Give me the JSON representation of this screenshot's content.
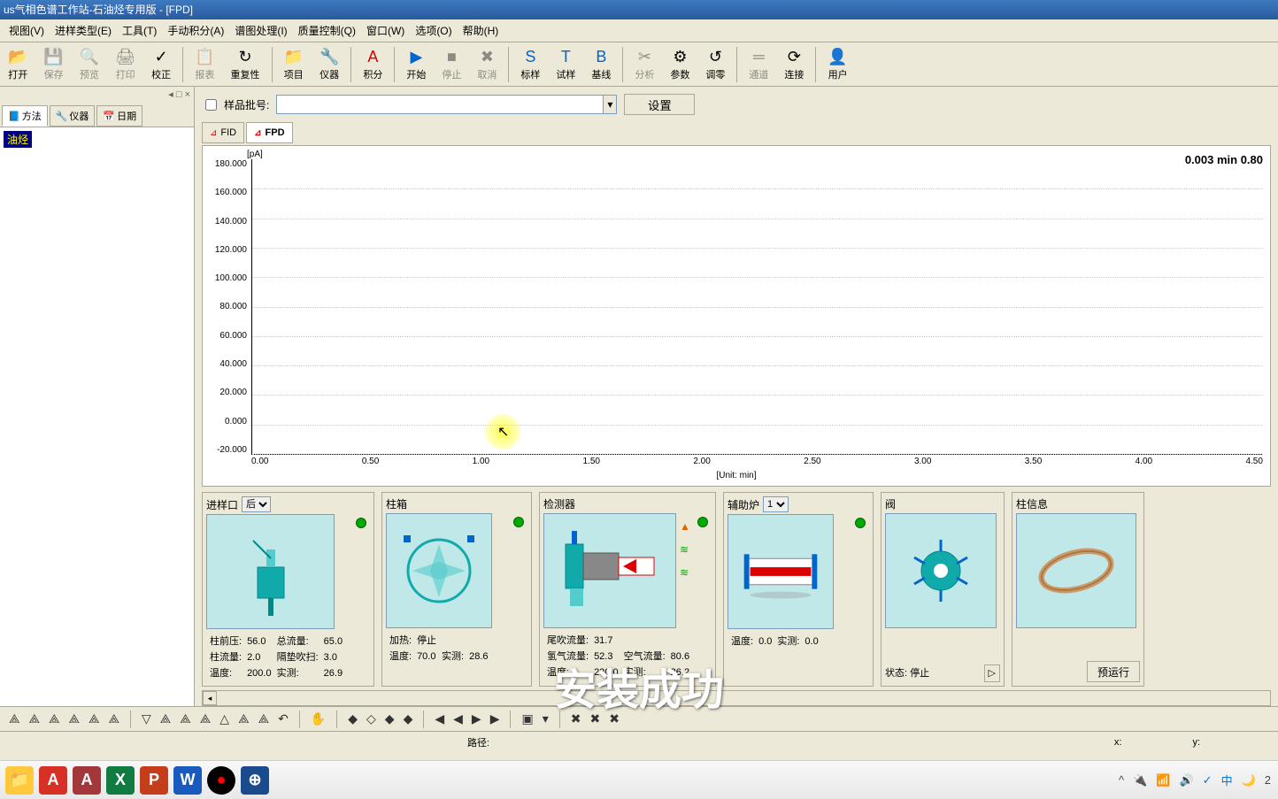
{
  "title": "us气相色谱工作站-石油烃专用版 - [FPD]",
  "menu": [
    "视图(V)",
    "进样类型(E)",
    "工具(T)",
    "手动积分(A)",
    "谱图处理(I)",
    "质量控制(Q)",
    "窗口(W)",
    "选项(O)",
    "帮助(H)"
  ],
  "toolbar": [
    {
      "icon": "📂",
      "label": "打开",
      "enabled": true
    },
    {
      "icon": "💾",
      "label": "保存",
      "enabled": false
    },
    {
      "icon": "🔍",
      "label": "预览",
      "enabled": false
    },
    {
      "icon": "🖨",
      "label": "打印",
      "enabled": false
    },
    {
      "icon": "✓",
      "label": "校正",
      "enabled": true
    },
    {
      "sep": true
    },
    {
      "icon": "📋",
      "label": "报表",
      "enabled": false
    },
    {
      "icon": "↻",
      "label": "重复性",
      "enabled": true
    },
    {
      "sep": true
    },
    {
      "icon": "📁",
      "label": "项目",
      "enabled": true
    },
    {
      "icon": "🔧",
      "label": "仪器",
      "enabled": true
    },
    {
      "sep": true
    },
    {
      "icon": "A",
      "label": "积分",
      "enabled": true,
      "color": "#d00"
    },
    {
      "sep": true
    },
    {
      "icon": "▶",
      "label": "开始",
      "enabled": true,
      "color": "#06c"
    },
    {
      "icon": "■",
      "label": "停止",
      "enabled": false
    },
    {
      "icon": "✖",
      "label": "取消",
      "enabled": false
    },
    {
      "sep": true
    },
    {
      "icon": "S",
      "label": "标样",
      "enabled": true,
      "color": "#06c"
    },
    {
      "icon": "T",
      "label": "试样",
      "enabled": true,
      "color": "#06c"
    },
    {
      "icon": "B",
      "label": "基线",
      "enabled": true,
      "color": "#06c"
    },
    {
      "sep": true
    },
    {
      "icon": "✂",
      "label": "分析",
      "enabled": false
    },
    {
      "icon": "⚙",
      "label": "参数",
      "enabled": true
    },
    {
      "icon": "↺",
      "label": "调零",
      "enabled": true
    },
    {
      "sep": true
    },
    {
      "icon": "═",
      "label": "通道",
      "enabled": false
    },
    {
      "icon": "⟳",
      "label": "连接",
      "enabled": true
    },
    {
      "sep": true
    },
    {
      "icon": "👤",
      "label": "用户",
      "enabled": true
    }
  ],
  "sidebar": {
    "closeLabel": "◂ □ ×",
    "tabs": [
      {
        "icon": "📘",
        "label": "方法"
      },
      {
        "icon": "🔧",
        "label": "仪器"
      },
      {
        "icon": "📅",
        "label": "日期"
      }
    ],
    "item": "油烃"
  },
  "batch": {
    "label": "样品批号:",
    "btn": "设置"
  },
  "chartTabs": [
    {
      "label": "FID"
    },
    {
      "label": "FPD",
      "active": true
    }
  ],
  "readout": "0.003 min  0.80",
  "chart_data": {
    "type": "line",
    "title": "",
    "xlabel": "[Unit: min]",
    "ylabel": "[pA]",
    "ylim": [
      -20,
      180
    ],
    "xlim": [
      0,
      4.5
    ],
    "y_ticks": [
      "180.000",
      "160.000",
      "140.000",
      "120.000",
      "100.000",
      "80.000",
      "60.000",
      "40.000",
      "20.000",
      "0.000",
      "-20.000"
    ],
    "x_ticks": [
      "0.00",
      "0.50",
      "1.00",
      "1.50",
      "2.00",
      "2.50",
      "3.00",
      "3.50",
      "4.00",
      "4.50"
    ],
    "series": [
      {
        "name": "FPD",
        "x": [],
        "y": []
      }
    ]
  },
  "panels": {
    "inlet": {
      "title": "进样口",
      "sel": "后",
      "rows": [
        [
          "柱前压:",
          "56.0",
          "总流量:",
          "65.0"
        ],
        [
          "柱流量:",
          "2.0",
          "隔垫吹扫:",
          "3.0"
        ],
        [
          "温度:",
          "200.0",
          "实测:",
          "26.9"
        ]
      ]
    },
    "oven": {
      "title": "柱箱",
      "rows": [
        [
          "加热:",
          "停止",
          "",
          ""
        ],
        [
          "温度:",
          "70.0",
          "实测:",
          "28.6"
        ]
      ]
    },
    "detector": {
      "title": "检测器",
      "rows": [
        [
          "尾吹流量:",
          "31.7",
          "",
          ""
        ],
        [
          "氢气流量:",
          "52.3",
          "空气流量:",
          "80.6"
        ],
        [
          "温度:",
          "230.0",
          "实测:",
          "26.2"
        ]
      ]
    },
    "aux": {
      "title": "辅助炉",
      "sel": "1",
      "rows": [
        [
          "温度:",
          "0.0",
          "实测:",
          "0.0"
        ]
      ]
    },
    "valve": {
      "title": "阀",
      "rows": [
        [
          "状态:",
          "停止",
          "",
          ""
        ]
      ]
    },
    "column": {
      "title": "柱信息",
      "btn": "预运行"
    }
  },
  "overlay": "安装成功",
  "status": {
    "path": "路径:",
    "x": "x:",
    "y": "y:"
  },
  "tray": [
    "✓",
    "中",
    "🌙"
  ]
}
